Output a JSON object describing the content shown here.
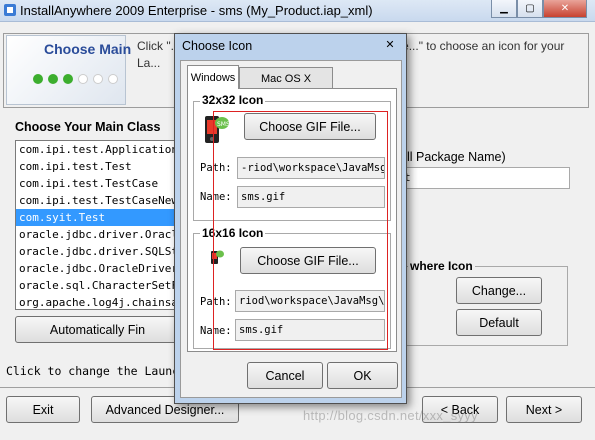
{
  "window": {
    "title": "InstallAnywhere 2009 Enterprise - sms (My_Product.iap_xml)"
  },
  "header": {
    "logo_text": "Choose Main",
    "description": "Click \"... main classes, or type the name ... Change...\" to choose an icon for your La..."
  },
  "main_class": {
    "section_title": "Choose Your Main Class",
    "list_items": [
      "com.ipi.test.Application1",
      "com.ipi.test.Test",
      "com.ipi.test.TestCase",
      "com.ipi.test.TestCaseNew",
      "com.syit.Test",
      "oracle.jdbc.driver.OracleSe",
      "oracle.jdbc.driver.SQLStat",
      "oracle.jdbc.OracleDriver",
      "oracle.sql.CharacterSetFac",
      "org.apache.log4j.chainsaw."
    ],
    "selected_index": 4,
    "auto_find_label": "Automatically Fin"
  },
  "right_panel": {
    "full_package_label": "ull Package Name)",
    "full_package_value": "t",
    "icon_group_title": "where Icon",
    "change_label": "Change...",
    "default_label": "Default"
  },
  "status_hint": "Click to change the LaunchAn",
  "bottom": {
    "exit_label": "Exit",
    "advanced_label": "Advanced Designer...",
    "back_label": "< Back",
    "next_label": "Next >"
  },
  "dialog": {
    "title": "Choose Icon",
    "close_glyph": "✕",
    "tabs": [
      {
        "label": "Windows",
        "active": true
      },
      {
        "label": "Mac OS X",
        "active": false
      }
    ],
    "group32": {
      "title": "32x32 Icon",
      "choose_label": "Choose GIF File...",
      "path_label": "Path:",
      "path_value": "-riod\\workspace\\JavaMsg\\",
      "name_label": "Name:",
      "name_value": "sms.gif"
    },
    "group16": {
      "title": "16x16 Icon",
      "choose_label": "Choose GIF File...",
      "path_label": "Path:",
      "path_value": "riod\\workspace\\JavaMsg\\",
      "name_label": "Name:",
      "name_value": "sms.gif"
    },
    "cancel_label": "Cancel",
    "ok_label": "OK"
  },
  "watermark": "http://blog.csdn.net/xxx_syyy",
  "colors": {
    "selection": "#3399ff",
    "annotation_red": "#dd2222",
    "dialog_frame": "#bcd2ec"
  }
}
